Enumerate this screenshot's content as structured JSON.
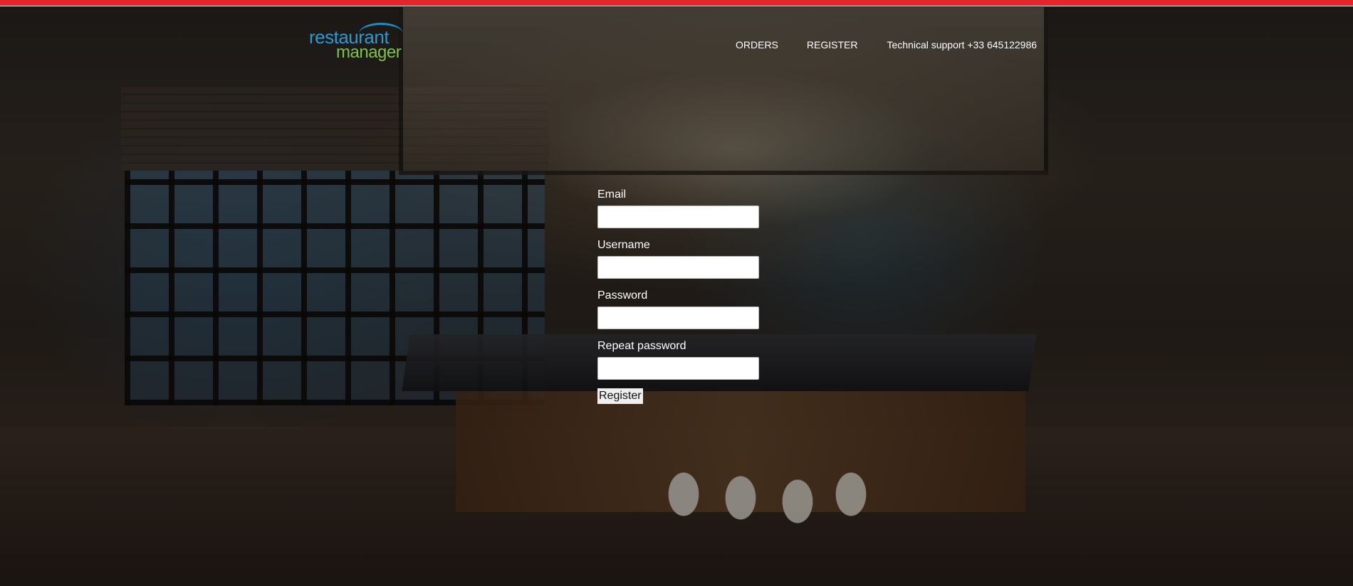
{
  "header": {
    "logo": {
      "line1": "restaurant",
      "line2": "manager"
    },
    "nav": {
      "orders_label": "ORDERS",
      "register_label": "REGISTER",
      "support_text": "Technical support +33 645122986"
    }
  },
  "form": {
    "email_label": "Email",
    "email_value": "",
    "username_label": "Username",
    "username_value": "",
    "password_label": "Password",
    "password_value": "",
    "repeat_password_label": "Repeat password",
    "repeat_password_value": "",
    "submit_label": "Register"
  },
  "colors": {
    "top_stripe": "#e3262c",
    "logo_blue": "#2a9ad0",
    "logo_green": "#7dc243"
  },
  "icons": {
    "logo": "restaurant-manager-logo"
  }
}
